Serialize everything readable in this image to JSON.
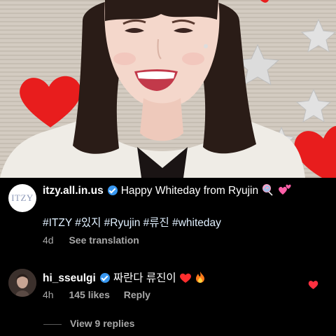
{
  "post": {
    "username": "itzy.all.in.us",
    "caption": "Happy Whiteday from Ryujin",
    "hashtags": "#ITZY #있지 #Ryujin #류진 #whiteday",
    "time": "4d",
    "see_translation": "See translation",
    "avatar_text": "ITZY"
  },
  "reply": {
    "username": "hi_sseulgi",
    "text": "짜란다 류진이",
    "time": "4h",
    "likes": "145 likes",
    "reply_label": "Reply"
  },
  "view_replies": "View 9 replies",
  "colors": {
    "verified": "#3897f0",
    "heart": "#ff3040",
    "muted": "#a8a8a8"
  }
}
